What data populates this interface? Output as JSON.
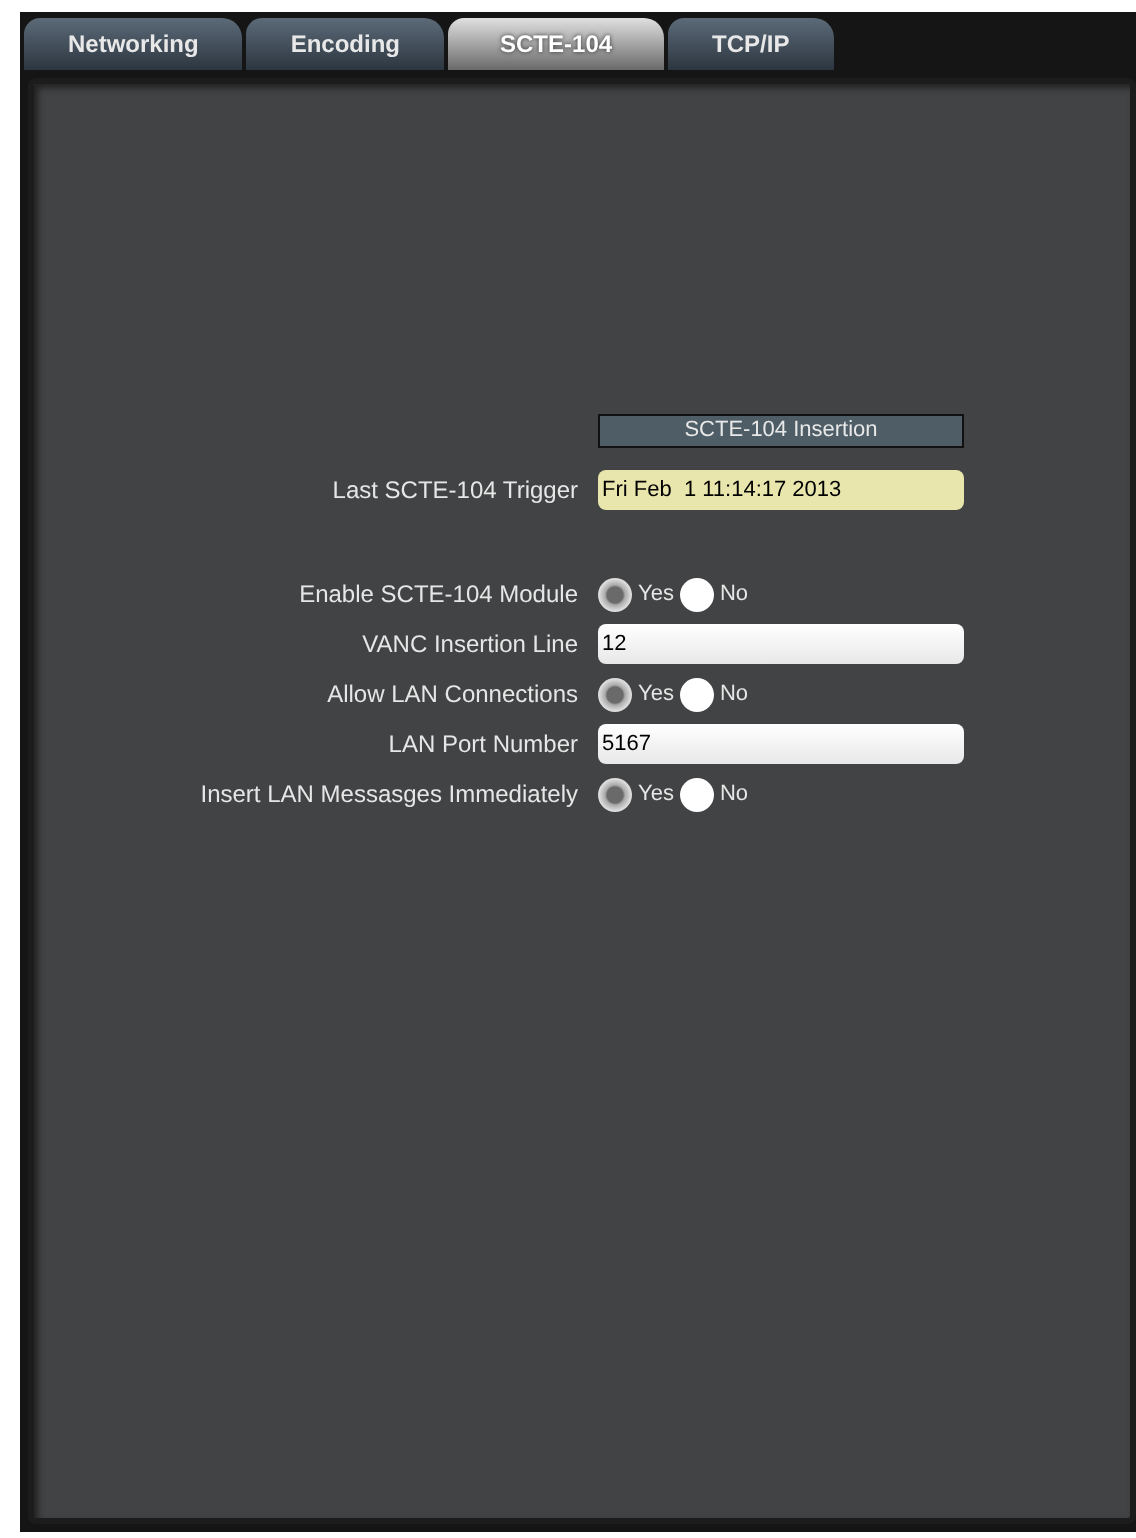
{
  "tabs": [
    {
      "label": "Networking",
      "selected": false
    },
    {
      "label": "Encoding",
      "selected": false
    },
    {
      "label": "SCTE-104",
      "selected": true
    },
    {
      "label": "TCP/IP",
      "selected": false
    }
  ],
  "section": {
    "title": "SCTE-104 Insertion"
  },
  "rows": [
    {
      "kind": "readonly",
      "label": "Last SCTE-104 Trigger",
      "value": "Fri Feb  1 11:14:17 2013"
    },
    {
      "kind": "spacer"
    },
    {
      "kind": "radio",
      "label": "Enable SCTE-104 Module",
      "options": [
        {
          "label": "Yes",
          "selected": true
        },
        {
          "label": "No",
          "selected": false
        }
      ]
    },
    {
      "kind": "field",
      "label": "VANC Insertion Line",
      "value": "12"
    },
    {
      "kind": "radio",
      "label": "Allow LAN Connections",
      "options": [
        {
          "label": "Yes",
          "selected": true
        },
        {
          "label": "No",
          "selected": false
        }
      ]
    },
    {
      "kind": "field",
      "label": "LAN Port Number",
      "value": "5167"
    },
    {
      "kind": "radio",
      "label": "Insert LAN Messasges Immediately",
      "options": [
        {
          "label": "Yes",
          "selected": true
        },
        {
          "label": "No",
          "selected": false
        }
      ]
    }
  ]
}
